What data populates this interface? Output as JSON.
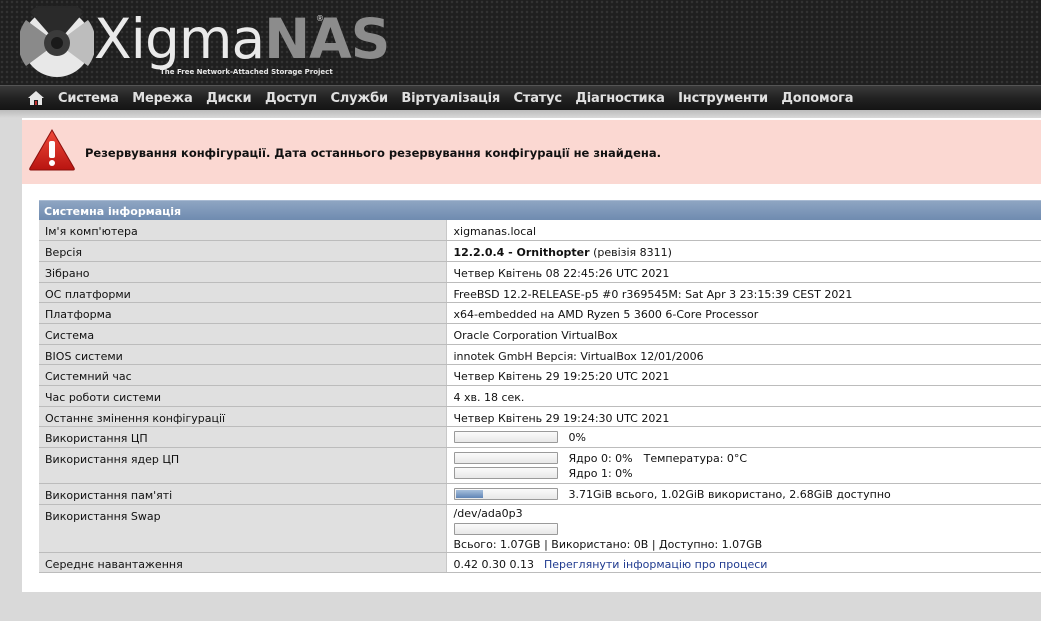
{
  "logo": {
    "name_part1": "Xigma",
    "name_part2": "NAS",
    "registered": "®",
    "tagline": "The Free Network-Attached Storage Project"
  },
  "nav": {
    "home_icon": "home-icon",
    "items": [
      "Система",
      "Мережа",
      "Диски",
      "Доступ",
      "Служби",
      "Віртуалізація",
      "Статус",
      "Діагностика",
      "Інструменти",
      "Допомога"
    ]
  },
  "alert": {
    "icon": "warning-icon",
    "text": "Резервування конфігурації. Дата останнього резервування конфігурації не знайдена."
  },
  "info": {
    "title": "Системна інформація",
    "hostname": {
      "label": "Ім'я комп'ютера",
      "value": "xigmanas.local"
    },
    "version": {
      "label": "Версія",
      "value_bold": "12.2.0.4 - Ornithopter",
      "value_rest": " (ревізія 8311)"
    },
    "built": {
      "label": "Зібрано",
      "value": "Четвер Квітень 08 22:45:26 UTC 2021"
    },
    "platform_os": {
      "label": "ОС платформи",
      "value": "FreeBSD 12.2-RELEASE-p5 #0 r369545M: Sat Apr 3 23:15:39 CEST 2021"
    },
    "platform": {
      "label": "Платформа",
      "value": "x64-embedded на AMD Ryzen 5 3600 6-Core Processor"
    },
    "system": {
      "label": "Система",
      "value": "Oracle Corporation VirtualBox"
    },
    "bios": {
      "label": "BIOS системи",
      "value": "innotek GmbH Версія: VirtualBox 12/01/2006"
    },
    "clock": {
      "label": "Системний час",
      "value": "Четвер Квітень 29 19:25:20 UTC 2021"
    },
    "uptime": {
      "label": "Час роботи системи",
      "value": "4 хв. 18 сек."
    },
    "last_config": {
      "label": "Останнє змінення конфігурації",
      "value": "Четвер Квітень 29 19:24:30 UTC 2021"
    },
    "cpu": {
      "label": "Використання ЦП",
      "value": "0%",
      "fraction": 0
    },
    "cores": {
      "label": "Використання ядер ЦП",
      "core0": "Ядро 0: 0%",
      "temp": "Температура: 0°C",
      "core1": "Ядро 1: 0%",
      "core0_fraction": 0,
      "core1_fraction": 0
    },
    "memory": {
      "label": "Використання пам'яті",
      "value": "3.71GiB всього, 1.02GiB використано, 2.68GiB доступно",
      "fraction": 0.27
    },
    "swap": {
      "label": "Використання Swap",
      "device": "/dev/ada0p3",
      "summary": "Всього: 1.07GB | Використано: 0B | Доступно: 1.07GB",
      "fraction": 0
    },
    "load": {
      "label": "Середнє навантаження",
      "value": "0.42 0.30 0.13",
      "link": "Переглянути інформацію про процеси"
    }
  }
}
